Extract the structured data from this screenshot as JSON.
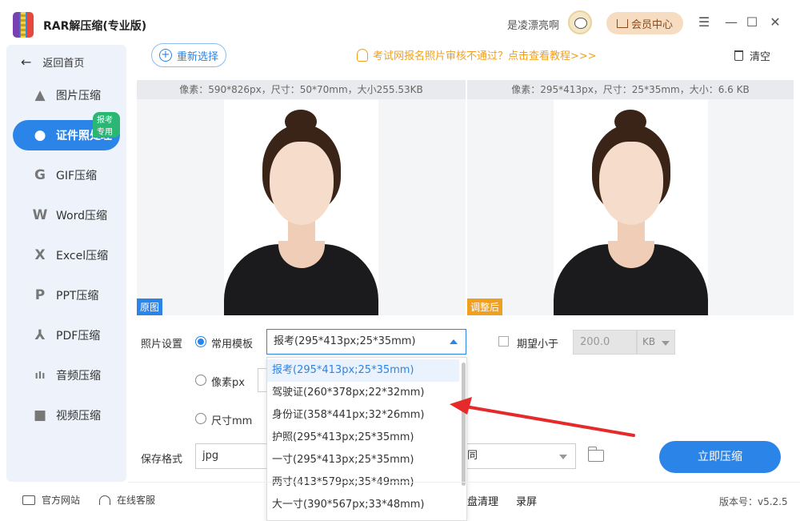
{
  "app": {
    "title": "RAR解压缩(专业版)"
  },
  "header": {
    "user_name": "是凌漂亮啊",
    "vip_label": "会员中心",
    "menu_icon": "menu-icon",
    "minimize_icon": "minimize-icon",
    "maximize_icon": "maximize-icon",
    "close_icon": "close-icon"
  },
  "sidebar": {
    "back_label": "返回首页",
    "items": [
      {
        "label": "图片压缩",
        "icon": "image-compress-icon",
        "glyph": "▲"
      },
      {
        "label": "证件照处理",
        "icon": "id-photo-icon",
        "glyph": "●",
        "active": true,
        "badge": "报考专用"
      },
      {
        "label": "GIF压缩",
        "icon": "gif-icon",
        "glyph": "G"
      },
      {
        "label": "Word压缩",
        "icon": "word-icon",
        "glyph": "W"
      },
      {
        "label": "Excel压缩",
        "icon": "excel-icon",
        "glyph": "X"
      },
      {
        "label": "PPT压缩",
        "icon": "ppt-icon",
        "glyph": "P"
      },
      {
        "label": "PDF压缩",
        "icon": "pdf-icon",
        "glyph": "⅄"
      },
      {
        "label": "音频压缩",
        "icon": "audio-icon",
        "glyph": "ıIı"
      },
      {
        "label": "视频压缩",
        "icon": "video-icon",
        "glyph": "■"
      }
    ]
  },
  "toolbar": {
    "reselect_label": "重新选择",
    "tip_text": "考试网报名照片审核不通过？点击查看教程>>>",
    "clear_label": "清空"
  },
  "preview": {
    "original": {
      "info": "像素：590*826px，尺寸：50*70mm，大小255.53KB",
      "tag": "原图"
    },
    "adjusted": {
      "info": "像素：295*413px，尺寸：25*35mm，大小：6.6 KB",
      "tag": "调整后"
    }
  },
  "settings": {
    "photo_settings_label": "照片设置",
    "template_radio_label": "常用模板",
    "template_selected": "报考(295*413px;25*35mm)",
    "size_limit_label": "期望小于",
    "size_limit_value": "200.0",
    "size_limit_unit": "KB",
    "pixel_radio_label": "像素px",
    "mm_radio_label": "尺寸mm",
    "save_format_label": "保存格式",
    "save_format_value": "jpg",
    "output_dir_value": "同",
    "compress_button": "立即压缩",
    "template_options": [
      "报考(295*413px;25*35mm)",
      "驾驶证(260*378px;22*32mm)",
      "身份证(358*441px;32*26mm)",
      "护照(295*413px;25*35mm)",
      "一寸(295*413px;25*35mm)",
      "两寸(413*579px;35*49mm)",
      "大一寸(390*567px;33*48mm)"
    ]
  },
  "footer": {
    "website_label": "官方网站",
    "support_label": "在线客服",
    "tool_disk_clean": "盘清理",
    "tool_record": "录屏",
    "version": "版本号：v5.2.5"
  },
  "colors": {
    "accent": "#2b84e8",
    "tip": "#f0a020",
    "badge": "#2bb673",
    "arrow": "#e52a2a"
  }
}
